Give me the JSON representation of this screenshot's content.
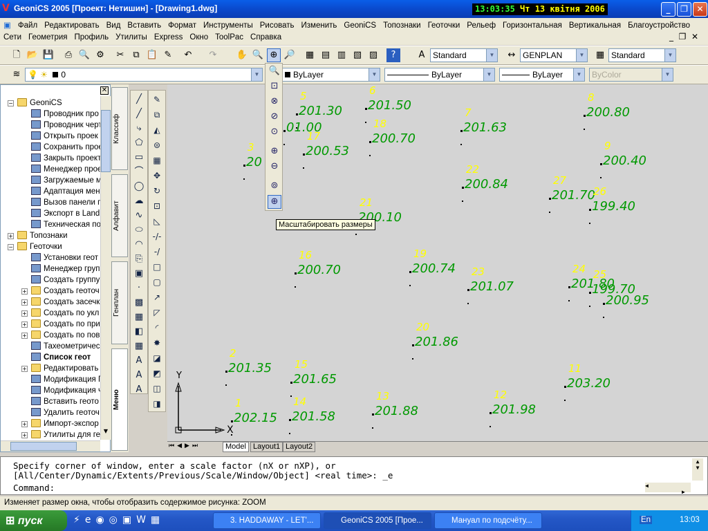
{
  "window": {
    "title": "GeoniCS 2005 [Проект: Нетишин] - [Drawing1.dwg]",
    "clock_time": "13:03:35",
    "clock_date": "Чт 13 квітня 2006"
  },
  "menu1": [
    "Файл",
    "Редактировать",
    "Вид",
    "Вставить",
    "Формат",
    "Инструменты",
    "Рисовать",
    "Изменить",
    "GeoniCS",
    "Топознаки",
    "Геоточки",
    "Рельеф",
    "Горизонтальная",
    "Вертикальная",
    "Благоустройство"
  ],
  "menu2": [
    "Сети",
    "Геометрия",
    "Профиль",
    "Утилиты",
    "Express",
    "Окно",
    "ToolPac",
    "Справка"
  ],
  "toolbar": {
    "text_style": "Standard",
    "dim_style": "GENPLAN",
    "table_style": "Standard",
    "layer": "0",
    "color": "ByLayer",
    "linetype": "ByLayer",
    "lineweight": "ByLayer",
    "plotstyle": "ByColor"
  },
  "tree": [
    {
      "label": "GeoniCS",
      "icon": "folder-icon"
    },
    {
      "label": "Проводник про",
      "icon": "explorer-icon"
    },
    {
      "label": "Проводник черт",
      "icon": "explorer-icon"
    },
    {
      "label": "Открыть проек",
      "icon": "open-icon"
    },
    {
      "label": "Сохранить прое",
      "icon": "save-icon"
    },
    {
      "label": "Закрыть проект",
      "icon": "close-icon"
    },
    {
      "label": "Менеджер прое",
      "icon": "manager-icon"
    },
    {
      "label": "Загружаемые м",
      "icon": "load-icon"
    },
    {
      "label": "Адаптация мен",
      "icon": "adapt-icon"
    },
    {
      "label": "Вызов панели г",
      "icon": "panel-icon"
    },
    {
      "label": "Экспорт в Land",
      "icon": "export-icon"
    },
    {
      "label": "Техническая по",
      "icon": "support-icon"
    },
    {
      "label": "Топознаки",
      "icon": "folder-icon"
    },
    {
      "label": "Геоточки",
      "icon": "folder-icon"
    },
    {
      "label": "Установки геот",
      "icon": "settings-icon"
    },
    {
      "label": "Менеджер груп",
      "icon": "manager-icon"
    },
    {
      "label": "Создать группу",
      "icon": "group-icon"
    },
    {
      "label": "Создать геоточ",
      "icon": "folder-icon"
    },
    {
      "label": "Создать засечк",
      "icon": "folder-icon"
    },
    {
      "label": "Создать по укл",
      "icon": "folder-icon"
    },
    {
      "label": "Создать по при",
      "icon": "folder-icon"
    },
    {
      "label": "Создать по пов",
      "icon": "folder-icon"
    },
    {
      "label": "Тахеометричес",
      "icon": "tacheo-icon"
    },
    {
      "label": "Список геот",
      "icon": "list-icon"
    },
    {
      "label": "Редактировать",
      "icon": "folder-icon"
    },
    {
      "label": "Модификация Г",
      "icon": "modify-icon"
    },
    {
      "label": "Модификация ч",
      "icon": "modify-icon"
    },
    {
      "label": "Вставить геото",
      "icon": "insert-icon"
    },
    {
      "label": "Удалить геоточ",
      "icon": "delete-icon"
    },
    {
      "label": "Импорт-экспор",
      "icon": "folder-icon"
    },
    {
      "label": "Утилиты для ге",
      "icon": "folder-icon"
    }
  ],
  "vtabs": [
    "Классиф",
    "Алфавит",
    "Генплан",
    "Меню"
  ],
  "points": [
    {
      "num": "5",
      "elev": "201.30"
    },
    {
      "num": "6",
      "elev": "201.50"
    },
    {
      "num": "",
      "elev": "01.00"
    },
    {
      "num": "18",
      "elev": "200.70"
    },
    {
      "num": "7",
      "elev": "201.63"
    },
    {
      "num": "8",
      "elev": "200.80"
    },
    {
      "num": "17",
      "elev": "200.53"
    },
    {
      "num": "3",
      "elev": "20"
    },
    {
      "num": "9",
      "elev": "200.40"
    },
    {
      "num": "22",
      "elev": "200.84"
    },
    {
      "num": "27",
      "elev": "201.70"
    },
    {
      "num": "26",
      "elev": "199.40"
    },
    {
      "num": "21",
      "elev": "200.10"
    },
    {
      "num": "16",
      "elev": "200.70"
    },
    {
      "num": "19",
      "elev": "200.74"
    },
    {
      "num": "23",
      "elev": "201.07"
    },
    {
      "num": "24",
      "elev": "201.80"
    },
    {
      "num": "25",
      "elev": "199.70"
    },
    {
      "num": "",
      "elev": "200.95"
    },
    {
      "num": "20",
      "elev": "201.86"
    },
    {
      "num": "2",
      "elev": "201.35"
    },
    {
      "num": "15",
      "elev": "201.65"
    },
    {
      "num": "11",
      "elev": "203.20"
    },
    {
      "num": "1",
      "elev": "202.15"
    },
    {
      "num": "14",
      "elev": "201.58"
    },
    {
      "num": "13",
      "elev": "201.88"
    },
    {
      "num": "12",
      "elev": "201.98"
    }
  ],
  "ucs": {
    "x": "X",
    "y": "Y"
  },
  "tooltip": "Масштабировать размеры",
  "layout_tabs": [
    "Model",
    "Layout1",
    "Layout2"
  ],
  "command": {
    "line1": "Specify corner of window, enter a scale factor (nX or nXP), or",
    "line2": "[All/Center/Dynamic/Extents/Previous/Scale/Window/Object] <real time>: _e",
    "line3": "Command:"
  },
  "status": "Изменяет размер окна, чтобы отобразить содержимое рисунка: ZOOM",
  "taskbar": {
    "start": "пуск",
    "tasks": [
      "3. HADDAWAY - LET'...",
      "GeoniCS 2005 [Прое...",
      "Мануал по подсчёту..."
    ],
    "lang1": "EN",
    "lang2": "En",
    "time": "13:03"
  }
}
